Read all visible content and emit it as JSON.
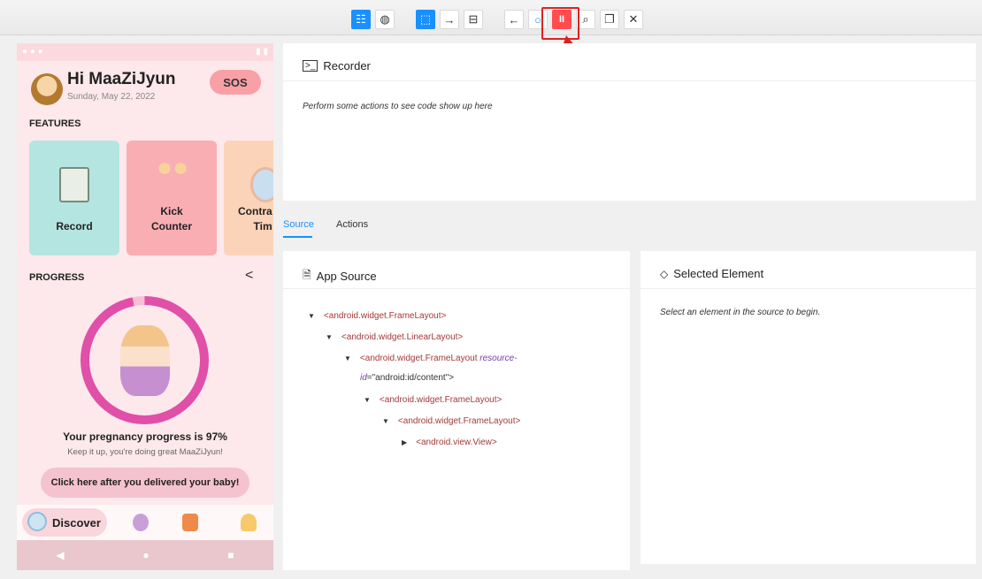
{
  "toolbar": {
    "buttons": [
      {
        "name": "native-mode-icon",
        "glyph": "☷"
      },
      {
        "name": "web-mode-icon",
        "glyph": "◍"
      },
      {
        "name": "select-element-icon",
        "glyph": "⬚"
      },
      {
        "name": "swipe-icon",
        "glyph": "→"
      },
      {
        "name": "tap-coordinates-icon",
        "glyph": "⊟"
      },
      {
        "name": "back-icon",
        "glyph": "←"
      },
      {
        "name": "refresh-icon",
        "glyph": "○"
      },
      {
        "name": "pause-recording-icon",
        "glyph": "II"
      },
      {
        "name": "search-icon",
        "glyph": "⌕"
      },
      {
        "name": "copy-icon",
        "glyph": "❐"
      },
      {
        "name": "close-icon",
        "glyph": "✕"
      }
    ]
  },
  "phone": {
    "greeting": "Hi MaaZiJyun",
    "date": "Sunday, May 22, 2022",
    "sos": "SOS",
    "features_title": "FEATURES",
    "features": [
      {
        "label": "Record"
      },
      {
        "label": "Kick\nCounter"
      },
      {
        "label": "Contra\nTim"
      }
    ],
    "progress_title": "PROGRESS",
    "progress_percent": 97,
    "progress_text": "Your pregnancy progress is 97%",
    "progress_sub": "Keep it up, you're doing great MaaZiJyun!",
    "delivered_button": "Click here after you delivered your baby!",
    "nav_discover": "Discover"
  },
  "recorder": {
    "title": "Recorder",
    "placeholder": "Perform some actions to see code show up here"
  },
  "tabs": {
    "source": "Source",
    "actions": "Actions"
  },
  "app_source": {
    "title": "App Source",
    "tree": [
      {
        "text": "<android.widget.FrameLayout>"
      },
      {
        "text": "<android.widget.LinearLayout>"
      },
      {
        "text": "<android.widget.FrameLayout",
        "attr": "resource-",
        "attr2": "id",
        "val": "=\"android:id/content\">"
      },
      {
        "text": "<android.widget.FrameLayout>"
      },
      {
        "text": "<android.widget.FrameLayout>"
      },
      {
        "text": "<android.view.View>"
      }
    ]
  },
  "selected_element": {
    "title": "Selected Element",
    "placeholder": "Select an element in the source to begin."
  },
  "colors": {
    "accent_blue": "#1890ff",
    "record_red": "#ff4d4f",
    "annotation_red": "#e02020"
  }
}
